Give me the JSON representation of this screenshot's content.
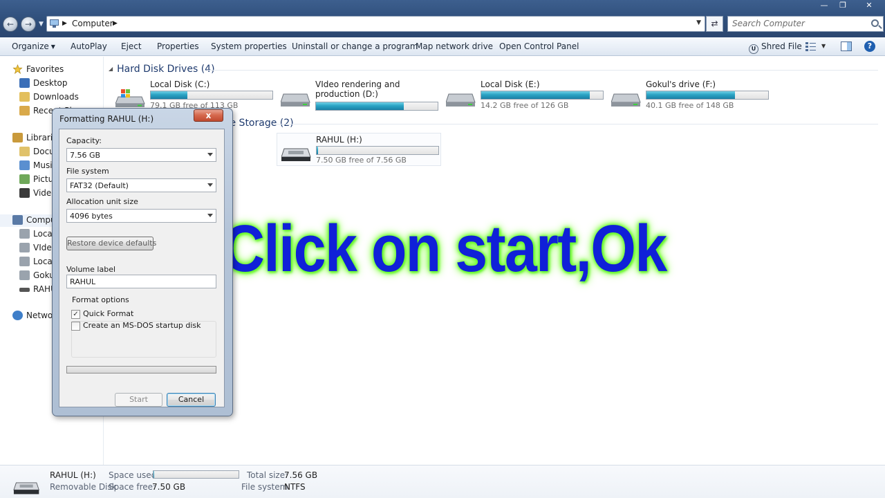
{
  "address": {
    "crumbs": [
      "Computer"
    ],
    "search_placeholder": "Search Computer"
  },
  "toolbar": {
    "items": [
      {
        "label": "Organize",
        "has_dropdown": true
      },
      {
        "label": "AutoPlay"
      },
      {
        "label": "Eject"
      },
      {
        "label": "Properties"
      },
      {
        "label": "System properties"
      },
      {
        "label": "Uninstall or change a program"
      },
      {
        "label": "Map network drive"
      },
      {
        "label": "Open Control Panel"
      }
    ],
    "shred_label": "Shred File",
    "help": "?"
  },
  "nav": {
    "favorites": "Favorites",
    "desktop": "Desktop",
    "downloads": "Downloads",
    "recent": "Recent Places",
    "libraries": "Libraries",
    "documents": "Documents",
    "music": "Music",
    "pictures": "Pictures",
    "videos": "Videos",
    "computer": "Computer",
    "drive_c": "Local Disk (C:)",
    "drive_d": "VIdeo rendering and production (D:)",
    "drive_e": "Local Disk (E:)",
    "drive_f": "Gokul's drive (F:)",
    "drive_h": "RAHUL (H:)",
    "network": "Network"
  },
  "sections": {
    "hard_disk": "Hard Disk Drives (4)",
    "removable": "Devices with Removable Storage (2)"
  },
  "drives": [
    {
      "name": "Local Disk (C:)",
      "free": "79.1 GB free of 113 GB",
      "used_fraction": 0.3
    },
    {
      "name": "VIdeo rendering and production (D:)",
      "free": "",
      "used_fraction": 0.72
    },
    {
      "name": "Local Disk (E:)",
      "free": "14.2 GB free of 126 GB",
      "used_fraction": 0.89
    },
    {
      "name": "Gokul's drive (F:)",
      "free": "40.1 GB free of 148 GB",
      "used_fraction": 0.73
    },
    {
      "name": "RAHUL (H:)",
      "free": "7.50 GB free of 7.56 GB",
      "used_fraction": 0.01
    }
  ],
  "overlay_text": "Click on start,Ok",
  "dialog": {
    "title": "Formatting RAHUL (H:)",
    "close": "x",
    "capacity_label": "Capacity:",
    "capacity_value": "7.56 GB",
    "filesystem_label": "File system",
    "filesystem_value": "FAT32 (Default)",
    "allocation_label": "Allocation unit size",
    "allocation_value": "4096 bytes",
    "restore_button": "Restore device defaults",
    "volume_label": "Volume label",
    "volume_value": "RAHUL",
    "format_options": "Format options",
    "quick_format": "Quick Format",
    "quick_format_checked": true,
    "msdos": "Create an MS-DOS startup disk",
    "msdos_checked": false,
    "progress": 0,
    "start_button": "Start",
    "cancel_button": "Cancel"
  },
  "details": {
    "name": "RAHUL (H:)",
    "type": "Removable Disk",
    "space_used_label": "Space used:",
    "space_used_fraction": 0.01,
    "space_free_label": "Space free:",
    "space_free_value": "7.50 GB",
    "total_size_label": "Total size:",
    "total_size_value": "7.56 GB",
    "filesystem_label": "File system:",
    "filesystem_value": "NTFS"
  },
  "colors": {
    "accent": "#1f5fb0",
    "overlay_text": "#1020d8",
    "overlay_glow": "#70ff30",
    "drive_bar": "#2aa3c4",
    "close_button": "#d66a4f"
  }
}
